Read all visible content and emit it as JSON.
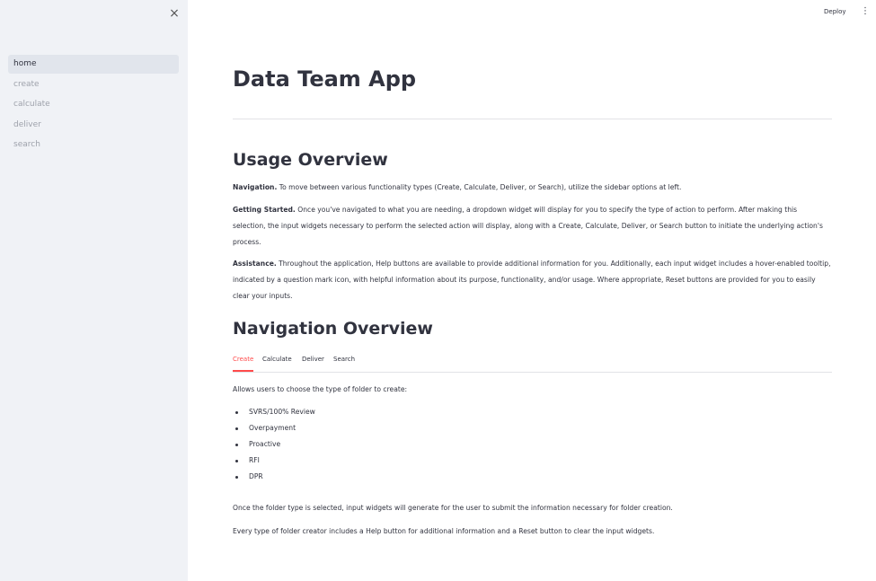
{
  "sidebar": {
    "close_icon": "×",
    "items": [
      {
        "label": "home",
        "active": true
      },
      {
        "label": "create"
      },
      {
        "label": "calculate"
      },
      {
        "label": "deliver"
      },
      {
        "label": "search"
      }
    ]
  },
  "header": {
    "deploy_label": "Deploy",
    "menu_icon": "⋮"
  },
  "main": {
    "title": "Data Team App",
    "usage": {
      "heading": "Usage Overview",
      "navigation_title": "Navigation.",
      "navigation_text": " To move between various functionality types (Create, Calculate, Deliver, or Search), utilize the sidebar options at left.",
      "getting_started_title": "Getting Started.",
      "getting_started_text": " Once you've navigated to what you are needing, a dropdown widget will display for you to specify the type of action to perform. After making this selection, the input widgets necessary to perform the selected action will display, along with a Create, Calculate, Deliver, or Search button to initiate the underlying action's process.",
      "assistance_title": "Assistance.",
      "assistance_text": " Throughout the application, Help buttons are available to provide additional information for you. Additionally, each input widget includes a hover-enabled tooltip, indicated by a question mark icon, with helpful information about its purpose, functionality, and/or usage. Where appropriate, Reset buttons are provided for you to easily clear your inputs."
    },
    "navigation": {
      "heading": "Navigation Overview",
      "tabs": [
        "Create",
        "Calculate",
        "Deliver",
        "Search"
      ],
      "active_tab": "Create",
      "intro": "Allows users to choose the type of folder to create:",
      "folder_types": [
        "SVRS/100% Review",
        "Overpayment",
        "Proactive",
        "RFI",
        "DPR"
      ],
      "after_select": "Once the folder type is selected, input widgets will generate for the user to submit the information necessary for folder creation.",
      "help_reset": "Every type of folder creator includes a Help button for additional information and a Reset button to clear the input widgets."
    }
  },
  "colors": {
    "sidebar_bg": "#f0f2f6",
    "active_nav_bg": "#e1e5ec",
    "accent": "#ff4b4b",
    "text": "#31333f",
    "muted_text": "#9ea2ab"
  }
}
